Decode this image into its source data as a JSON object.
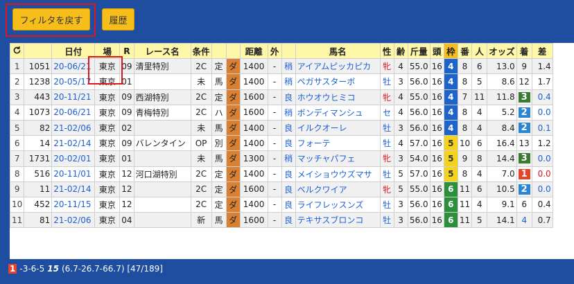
{
  "toolbar": {
    "filter_reset": "フィルタを戻す",
    "history": "履歴"
  },
  "headers": [
    "",
    "",
    "日付",
    "場",
    "R",
    "レース名",
    "条件",
    "",
    "",
    "距離",
    "外",
    "",
    "馬名",
    "性",
    "齢",
    "斤量",
    "頭",
    "枠",
    "番",
    "人",
    "オッズ",
    "着",
    "差"
  ],
  "rows": [
    [
      "1",
      "1051",
      "20-06/21",
      "東京",
      "09",
      "清里特別",
      "2C",
      "定",
      "ダ",
      "1400",
      "-",
      "稍",
      "アイアムピッカピカ",
      "牝",
      "4",
      "55.0",
      "16",
      "4",
      "8",
      "6",
      "13.0",
      "9",
      "1.4"
    ],
    [
      "2",
      "1238",
      "20-05/17",
      "東京",
      "01",
      "",
      "未",
      "馬",
      "ダ",
      "1400",
      "-",
      "稍",
      "ペガサスターボ",
      "牡",
      "3",
      "56.0",
      "16",
      "4",
      "8",
      "5",
      "8.6",
      "12",
      "1.7"
    ],
    [
      "3",
      "443",
      "20-11/21",
      "東京",
      "09",
      "西湖特別",
      "2C",
      "定",
      "ダ",
      "1600",
      "-",
      "良",
      "ホウオウヒミコ",
      "牝",
      "4",
      "55.0",
      "16",
      "4",
      "7",
      "11",
      "11.8",
      "3",
      "0.4"
    ],
    [
      "4",
      "1073",
      "20-06/21",
      "東京",
      "09",
      "青梅特別",
      "2C",
      "ハ",
      "ダ",
      "1600",
      "-",
      "稍",
      "ボンディマンシュ",
      "セ",
      "4",
      "56.0",
      "16",
      "4",
      "8",
      "4",
      "5.2",
      "2",
      "0.0"
    ],
    [
      "5",
      "82",
      "21-02/06",
      "東京",
      "02",
      "",
      "未",
      "馬",
      "ダ",
      "1400",
      "-",
      "良",
      "イルクオーレ",
      "牡",
      "3",
      "56.0",
      "16",
      "4",
      "8",
      "4",
      "8.4",
      "2",
      "0.1"
    ],
    [
      "6",
      "14",
      "21-02/14",
      "東京",
      "09",
      "バレンタイン",
      "OP",
      "別",
      "ダ",
      "1400",
      "-",
      "良",
      "フォーテ",
      "牡",
      "4",
      "57.0",
      "16",
      "5",
      "10",
      "6",
      "16.4",
      "13",
      "1.2"
    ],
    [
      "7",
      "1731",
      "20-02/01",
      "東京",
      "01",
      "",
      "未",
      "馬",
      "ダ",
      "1300",
      "-",
      "稍",
      "マッチャパフェ",
      "牝",
      "3",
      "54.0",
      "16",
      "5",
      "9",
      "8",
      "14.4",
      "3",
      "0.0"
    ],
    [
      "8",
      "516",
      "20-11/01",
      "東京",
      "12",
      "河口湖特別",
      "2C",
      "定",
      "ダ",
      "1400",
      "-",
      "良",
      "メイショウウズマサ",
      "牡",
      "5",
      "57.0",
      "16",
      "5",
      "8",
      "4",
      "7.0",
      "1",
      "0.0"
    ],
    [
      "9",
      "11",
      "21-02/14",
      "東京",
      "12",
      "",
      "2C",
      "定",
      "ダ",
      "1600",
      "-",
      "良",
      "ベルクワイア",
      "牝",
      "5",
      "55.0",
      "16",
      "6",
      "11",
      "6",
      "10.5",
      "2",
      "0.0"
    ],
    [
      "10",
      "452",
      "20-11/15",
      "東京",
      "12",
      "",
      "2C",
      "定",
      "ダ",
      "1400",
      "-",
      "良",
      "ライフレッスンズ",
      "牡",
      "3",
      "56.0",
      "16",
      "6",
      "11",
      "4",
      "9.1",
      "6",
      "0.4"
    ],
    [
      "11",
      "81",
      "21-02/06",
      "東京",
      "04",
      "",
      "新",
      "馬",
      "ダ",
      "1600",
      "-",
      "良",
      "テキサスブロンコ",
      "牡",
      "3",
      "56.0",
      "16",
      "6",
      "11",
      "5",
      "14.1",
      "4",
      "0.7"
    ]
  ],
  "footer": {
    "highlight": "1",
    "combo": "-3-6-5",
    "bold": "15",
    "detail": "(6.7-26.7-66.7) [47/189]"
  },
  "colors": {
    "background": "#1f4ea0",
    "button": "#f6bd1b",
    "header": "#fff7a8",
    "highlight_box": "#e0141b"
  }
}
